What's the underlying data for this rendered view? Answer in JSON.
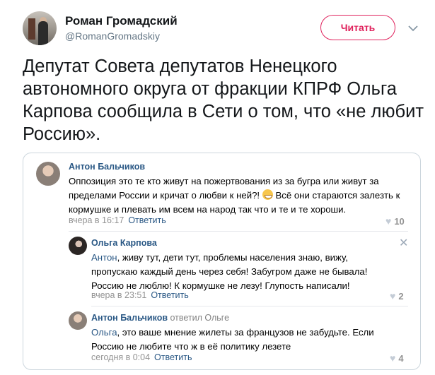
{
  "tweet": {
    "author": {
      "display_name": "Роман Громадский",
      "handle": "@RomanGromadskiy"
    },
    "follow_label": "Читать",
    "text": "Депутат Совета депутатов Ненецкого автономного округа от фракции КПРФ Ольга Карпова сообщила в Сети о том, что «не любит Россию»."
  },
  "screenshot": {
    "comments": [
      {
        "author": "Антон Бальчиков",
        "text_before_emoji": "Оппозиция это те кто живут на пожертвования из за бугра или живут за пределами России и кричат о любви к ней?!",
        "text_after_emoji": "Всё они стараются залезть к кормушке и плевать им всем на народ так что и те и те хороши.",
        "time": "вчера в 16:17",
        "reply_label": "Ответить",
        "likes": "10"
      },
      {
        "author": "Ольга Карпова",
        "mention": "Антон",
        "text": ", живу тут, дети тут, проблемы населения знаю, вижу, пропускаю каждый день через себя! Забугром даже не бывала! Россию не люблю! К кормушке не лезу! Глупость написали!",
        "time": "вчера в 23:51",
        "reply_label": "Ответить",
        "likes": "2",
        "close_icon": "close-icon"
      },
      {
        "author": "Антон Бальчиков",
        "replied_to": "ответил Ольге",
        "mention": "Ольга",
        "text": ", это ваше мнение жилеты за французов не забудьте. Если Россию не любите что ж в её политику лезете",
        "time": "сегодня в 0:04",
        "reply_label": "Ответить",
        "likes": "4"
      }
    ]
  },
  "colors": {
    "follow_accent": "#e0245e",
    "vk_link": "#2a5885",
    "secondary": "#657786"
  }
}
